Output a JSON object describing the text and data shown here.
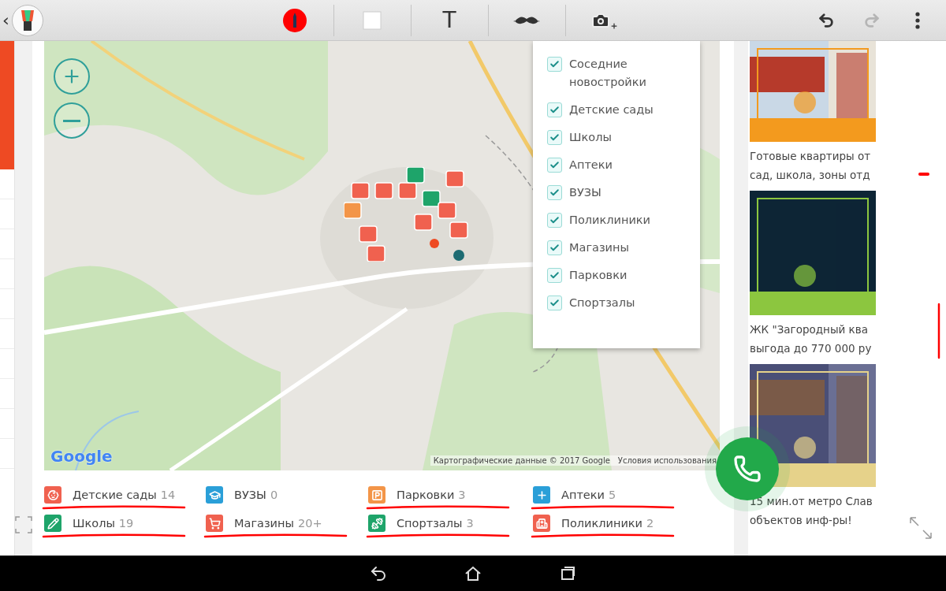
{
  "toolbar": {
    "text_tool": "T",
    "back": "‹",
    "redo_disabled": true
  },
  "map": {
    "attribution": "Картографические данные © 2017 Google",
    "terms": "Условия использования",
    "logo": "Google",
    "filters": [
      {
        "label": "Соседние новостройки",
        "checked": true
      },
      {
        "label": "Детские сады",
        "checked": true
      },
      {
        "label": "Школы",
        "checked": true
      },
      {
        "label": "Аптеки",
        "checked": true
      },
      {
        "label": "ВУЗЫ",
        "checked": true
      },
      {
        "label": "Поликлиники",
        "checked": true
      },
      {
        "label": "Магазины",
        "checked": true
      },
      {
        "label": "Парковки",
        "checked": true
      },
      {
        "label": "Спортзалы",
        "checked": true
      }
    ]
  },
  "legend": [
    {
      "kind": "kindergarten",
      "label": "Детские сады",
      "count": "14",
      "color": "#f0614f",
      "underlined": true
    },
    {
      "kind": "university",
      "label": "ВУЗЫ",
      "count": "0",
      "color": "#2a9fd8",
      "underlined": false
    },
    {
      "kind": "parking",
      "label": "Парковки",
      "count": "3",
      "color": "#f39548",
      "underlined": true
    },
    {
      "kind": "pharmacy",
      "label": "Аптеки",
      "count": "5",
      "color": "#2a9fd8",
      "underlined": true
    },
    {
      "kind": "school",
      "label": "Школы",
      "count": "19",
      "color": "#1ea46a",
      "underlined": true
    },
    {
      "kind": "shop",
      "label": "Магазины",
      "count": "20+",
      "color": "#f0614f",
      "underlined": true
    },
    {
      "kind": "gym",
      "label": "Спортзалы",
      "count": "3",
      "color": "#1ea46a",
      "underlined": true
    },
    {
      "kind": "clinic",
      "label": "Поликлиники",
      "count": "2",
      "color": "#f0614f",
      "underlined": true
    }
  ],
  "ads": [
    {
      "kind": "picture",
      "caption": "Готовые квартиры от\nсад, школа, зоны отд"
    },
    {
      "kind": "picture",
      "caption": "ЖК \"Загородный ква\nвыгода до 770 000 ру"
    },
    {
      "kind": "picture",
      "caption": "15 мин.от метро Слав\nобъектов инф-ры!"
    }
  ]
}
